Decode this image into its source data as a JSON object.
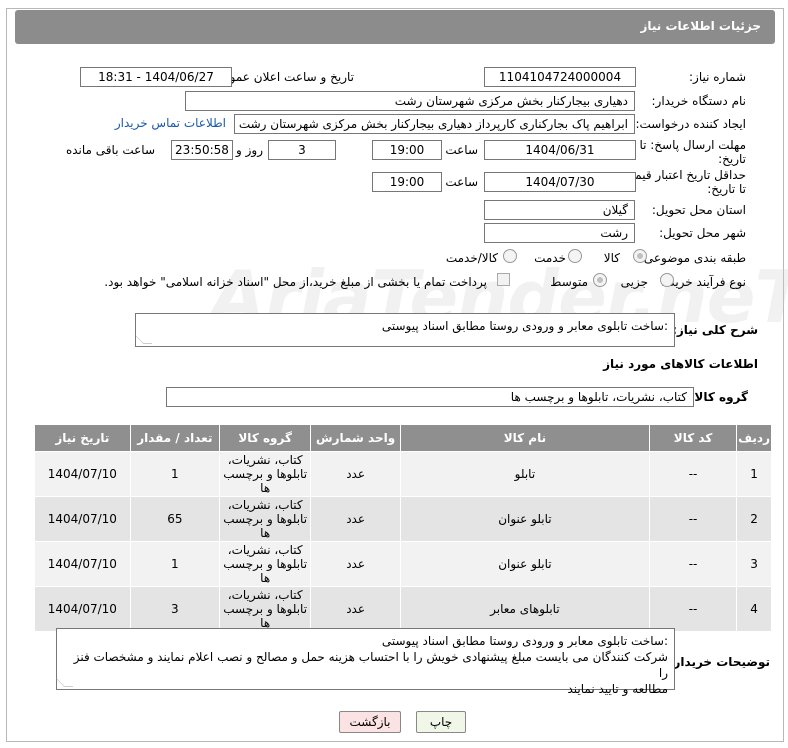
{
  "header": {
    "title": "جزئیات اطلاعات نیاز"
  },
  "watermark": "AriaTender.neT",
  "form": {
    "need_number_label": "شماره نیاز:",
    "need_number": "1104104724000004",
    "announce_label": "تاریخ و ساعت اعلان عمومی:",
    "announce_value": "1404/06/27 - 18:31",
    "buyer_org_label": "نام دستگاه خریدار:",
    "buyer_org": "دهیاری بیجارکنار بخش مرکزی شهرستان رشت",
    "creator_label": "ایجاد کننده درخواست:",
    "creator": "ابراهیم پاک بجارکناری کارپرداز دهیاری بیجارکنار بخش مرکزی شهرستان رشت",
    "contact_link": "اطلاعات تماس خریدار",
    "reply_deadline_label_1": "مهلت ارسال پاسخ: تا",
    "reply_deadline_label_2": "تاریخ:",
    "reply_date": "1404/06/31",
    "time_label": "ساعت",
    "reply_time": "19:00",
    "days_value": "3",
    "days_label": "روز و",
    "remaining_time": "23:50:58",
    "remaining_label": "ساعت باقی مانده",
    "price_valid_label_1": "حداقل تاریخ اعتبار قیمت:",
    "price_valid_label_2": "تا تاریخ:",
    "price_valid_date": "1404/07/30",
    "price_valid_time": "19:00",
    "province_label": "استان محل تحویل:",
    "province": "گیلان",
    "city_label": "شهر محل تحویل:",
    "city": "رشت",
    "category_label": "طبقه بندی موضوعی:",
    "category_options": [
      "کالا",
      "خدمت",
      "کالا/خدمت"
    ],
    "process_label": "نوع فرآیند خرید :",
    "process_options": [
      "جزیی",
      "متوسط"
    ],
    "payment_note": "پرداخت تمام یا بخشی از مبلغ خرید،از محل \"اسناد خزانه اسلامی\" خواهد بود.",
    "summary_label": "شرح کلی نیاز:",
    "summary": ":ساخت تابلوی معابر و ورودی روستا مطابق اسناد پیوستی",
    "goods_info_title": "اطلاعات کالاهای مورد نیاز",
    "goods_group_label": "گروه کالا:",
    "goods_group": "کتاب، نشریات، تابلوها و برچسب ها"
  },
  "table": {
    "headers": [
      "ردیف",
      "کد کالا",
      "نام کالا",
      "واحد شمارش",
      "گروه کالا",
      "تعداد / مقدار",
      "تاریخ نیاز"
    ],
    "rows": [
      {
        "row": "1",
        "code": "--",
        "name": "تابلو",
        "unit": "عدد",
        "group": "کتاب، نشریات، تابلوها و برچسب ها",
        "qty": "1",
        "date": "1404/07/10"
      },
      {
        "row": "2",
        "code": "--",
        "name": "تابلو عنوان",
        "unit": "عدد",
        "group": "کتاب، نشریات، تابلوها و برچسب ها",
        "qty": "65",
        "date": "1404/07/10"
      },
      {
        "row": "3",
        "code": "--",
        "name": "تابلو عنوان",
        "unit": "عدد",
        "group": "کتاب، نشریات، تابلوها و برچسب ها",
        "qty": "1",
        "date": "1404/07/10"
      },
      {
        "row": "4",
        "code": "--",
        "name": "تابلوهای معابر",
        "unit": "عدد",
        "group": "کتاب، نشریات، تابلوها و برچسب ها",
        "qty": "3",
        "date": "1404/07/10"
      }
    ]
  },
  "notes": {
    "label": "توضیحات خریدار:",
    "line1": ":ساخت تابلوی معابر و ورودی روستا مطابق اسناد پیوستی",
    "line2": "شرکت کنندگان می بایست مبلغ پیشنهادی خویش را با احتساب هزینه حمل و مصالح و نصب اعلام نمایند و مشخصات فنز را",
    "line3": "مطالعه و تایید نمایند"
  },
  "buttons": {
    "print": "چاپ",
    "back": "بازگشت"
  }
}
